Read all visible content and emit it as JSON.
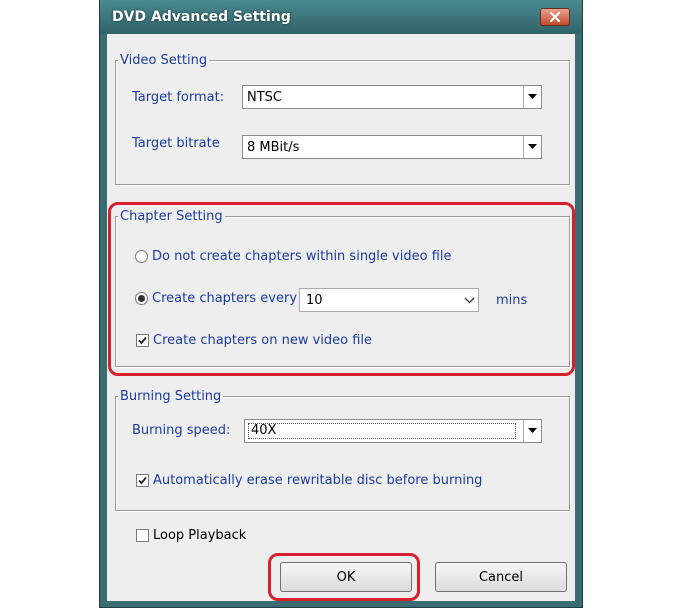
{
  "dialog": {
    "title": "DVD Advanced Setting",
    "close_icon": "close-icon"
  },
  "video_setting": {
    "legend": "Video Setting",
    "target_format_label": "Target format:",
    "target_format_value": "NTSC",
    "target_bitrate_label": "Target bitrate",
    "target_bitrate_value": "8 MBit/s"
  },
  "chapter_setting": {
    "legend": "Chapter Setting",
    "option_none_label": "Do not create chapters within single video file",
    "option_none_selected": false,
    "option_every_label": "Create chapters every",
    "option_every_selected": true,
    "every_value": "10",
    "every_unit": "mins",
    "new_file_label": "Create chapters on new video file",
    "new_file_checked": true
  },
  "burning_setting": {
    "legend": "Burning Setting",
    "speed_label": "Burning speed:",
    "speed_value": "40X",
    "erase_label": "Automatically erase rewritable  disc before burning",
    "erase_checked": true
  },
  "loop_playback": {
    "label": "Loop Playback",
    "checked": false
  },
  "buttons": {
    "ok_label": "OK",
    "cancel_label": "Cancel"
  },
  "colors": {
    "label_blue": "#1b3c9e",
    "highlight_red": "#d8212e",
    "frame_teal": "#3a6c72"
  }
}
